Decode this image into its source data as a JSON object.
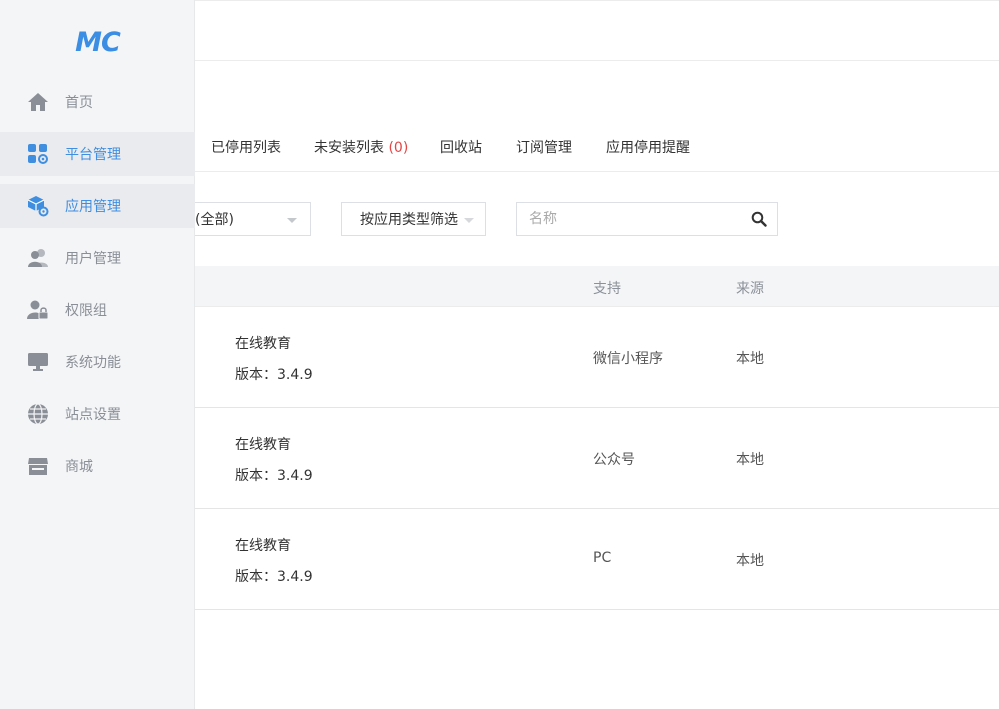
{
  "logo": {
    "text": "MC",
    "color": "#3b8ee4"
  },
  "sidebar": {
    "items": [
      {
        "label": "首页",
        "icon": "home-icon"
      },
      {
        "label": "平台管理",
        "icon": "grid-gear-icon"
      },
      {
        "label": "应用管理",
        "icon": "cube-gear-icon"
      },
      {
        "label": "用户管理",
        "icon": "users-icon"
      },
      {
        "label": "权限组",
        "icon": "user-lock-icon"
      },
      {
        "label": "系统功能",
        "icon": "monitor-icon"
      },
      {
        "label": "站点设置",
        "icon": "globe-icon"
      },
      {
        "label": "商城",
        "icon": "store-icon"
      }
    ]
  },
  "tabs": {
    "disabled_list": "已停用列表",
    "not_installed_label": "未安装列表",
    "not_installed_count": "(0)",
    "recycle_bin": "回收站",
    "subscription": "订阅管理",
    "disable_reminder": "应用停用提醒"
  },
  "filters": {
    "status_value": "(全部)",
    "type_value": "按应用类型筛选",
    "search_placeholder": "名称"
  },
  "table": {
    "columns": {
      "support": "支持",
      "source": "来源"
    },
    "version_prefix": "版本：",
    "rows": [
      {
        "name": "在线教育",
        "version": "版本：3.4.9",
        "support": "微信小程序",
        "source": "本地"
      },
      {
        "name": "在线教育",
        "version": "版本：3.4.9",
        "support": "公众号",
        "source": "本地"
      },
      {
        "name": "在线教育",
        "version": "版本：3.4.9",
        "support": "PC",
        "source": "本地"
      }
    ]
  },
  "colors": {
    "accent": "#3f8ee0",
    "danger": "#e44545",
    "sidebar_bg": "#f4f5f7",
    "icon_gray": "#8a8f97"
  }
}
